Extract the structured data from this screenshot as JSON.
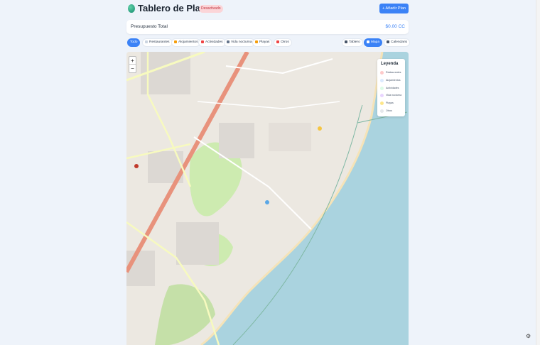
{
  "header": {
    "title": "Tablero de Planes",
    "badge": "Desactivado",
    "add_button": "+ Añadir Plan"
  },
  "budget": {
    "label": "Presupuesto Total",
    "value": "$0.00 CC"
  },
  "filters": {
    "categories": [
      {
        "label": "Todo",
        "active": true,
        "color": ""
      },
      {
        "label": "Restaurantes",
        "active": false,
        "color": "#e2e8f0"
      },
      {
        "label": "Alojamientos",
        "active": false,
        "color": "#f59e0b"
      },
      {
        "label": "Actividades",
        "active": false,
        "color": "#ef4444"
      },
      {
        "label": "Vida nocturna",
        "active": false,
        "color": "#64748b"
      },
      {
        "label": "Playas",
        "active": false,
        "color": "#f59e0b"
      },
      {
        "label": "Otros",
        "active": false,
        "color": "#ef4444"
      }
    ],
    "views": [
      {
        "label": "Tablero",
        "active": false
      },
      {
        "label": "Mapa",
        "active": true
      },
      {
        "label": "Calendario",
        "active": false
      }
    ]
  },
  "map": {
    "zoom_in": "+",
    "zoom_out": "−",
    "legend": {
      "title": "Leyenda",
      "items": [
        {
          "label": "Restaurantes",
          "color": "#fecaca"
        },
        {
          "label": "Alojamientos",
          "color": "#dbeafe"
        },
        {
          "label": "Actividades",
          "color": "#dcfce7"
        },
        {
          "label": "Vida nocturna",
          "color": "#e9d5ff"
        },
        {
          "label": "Playas",
          "color": "#fde68a"
        },
        {
          "label": "Otros",
          "color": "#e5e7eb"
        }
      ]
    },
    "colors": {
      "sea": "#aad3df",
      "land": "#ece8e1",
      "road": "#e8927c",
      "park": "#cdebb0"
    }
  },
  "corner_icon": "settings-icon"
}
